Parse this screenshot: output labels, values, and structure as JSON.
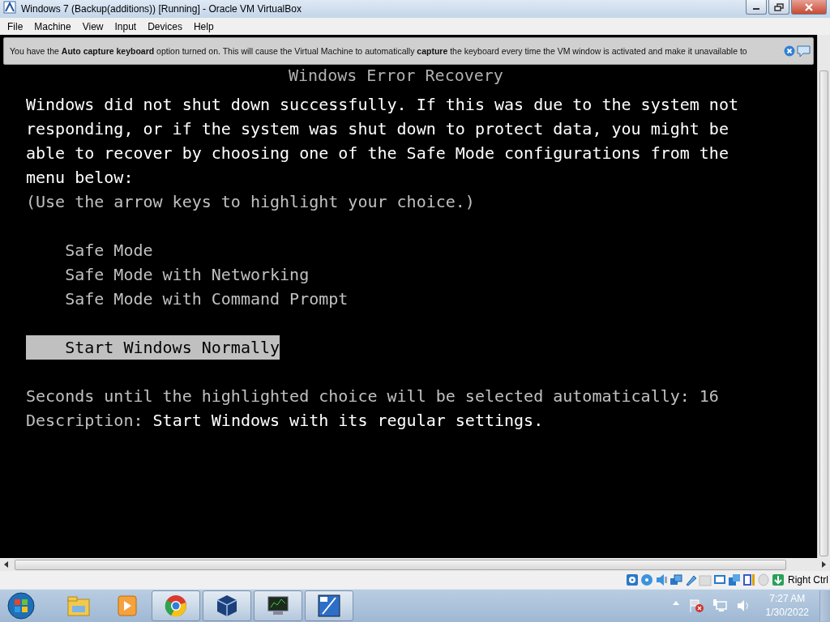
{
  "window": {
    "title": "Windows 7 (Backup(additions)) [Running] - Oracle VM VirtualBox"
  },
  "menu": [
    "File",
    "Machine",
    "View",
    "Input",
    "Devices",
    "Help"
  ],
  "notification": {
    "text": "You have the **Auto capture keyboard** option turned on. This will cause the Virtual Machine to automatically **capture** the keyboard every time the VM window is activated and make it unavailable to"
  },
  "console": {
    "title": "Windows Error Recovery",
    "message": "Windows did not shut down successfully. If this was due to the system not responding, or if the system was shut down to protect data, you might be able to recover by choosing one of the Safe Mode configurations from the menu below:",
    "hint": "(Use the arrow keys to highlight your choice.)",
    "option_groups": [
      {
        "options": [
          {
            "label": "Safe Mode",
            "selected": false
          },
          {
            "label": "Safe Mode with Networking",
            "selected": false
          },
          {
            "label": "Safe Mode with Command Prompt",
            "selected": false
          }
        ]
      },
      {
        "options": [
          {
            "label": "Start Windows Normally",
            "selected": true
          }
        ]
      }
    ],
    "countdown": "Seconds until the highlighted choice will be selected automatically: 16",
    "description_label": "Description:",
    "description": "Start Windows with its regular settings."
  },
  "status_bar": {
    "host_key": "Right Ctrl"
  },
  "taskbar": {
    "apps": [
      {
        "kind": "folder",
        "running": false
      },
      {
        "kind": "media",
        "running": false
      },
      {
        "kind": "browser",
        "running": true
      },
      {
        "kind": "cube",
        "running": true
      },
      {
        "kind": "monitor",
        "running": true
      },
      {
        "kind": "vm",
        "running": true
      }
    ],
    "time": "7:27 AM",
    "date": "1/30/2022"
  }
}
